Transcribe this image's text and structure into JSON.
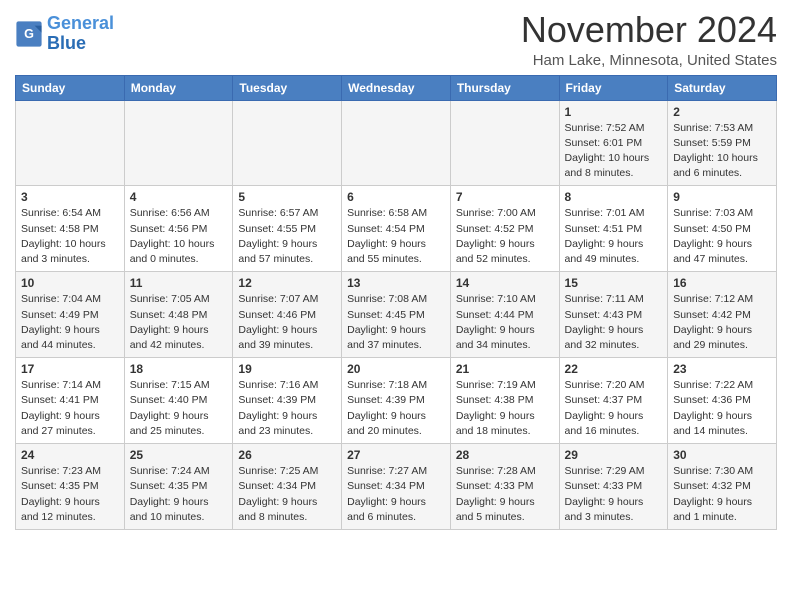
{
  "header": {
    "logo_line1": "General",
    "logo_line2": "Blue",
    "month": "November 2024",
    "location": "Ham Lake, Minnesota, United States"
  },
  "weekdays": [
    "Sunday",
    "Monday",
    "Tuesday",
    "Wednesday",
    "Thursday",
    "Friday",
    "Saturday"
  ],
  "weeks": [
    [
      {
        "day": "",
        "info": ""
      },
      {
        "day": "",
        "info": ""
      },
      {
        "day": "",
        "info": ""
      },
      {
        "day": "",
        "info": ""
      },
      {
        "day": "",
        "info": ""
      },
      {
        "day": "1",
        "info": "Sunrise: 7:52 AM\nSunset: 6:01 PM\nDaylight: 10 hours\nand 8 minutes."
      },
      {
        "day": "2",
        "info": "Sunrise: 7:53 AM\nSunset: 5:59 PM\nDaylight: 10 hours\nand 6 minutes."
      }
    ],
    [
      {
        "day": "3",
        "info": "Sunrise: 6:54 AM\nSunset: 4:58 PM\nDaylight: 10 hours\nand 3 minutes."
      },
      {
        "day": "4",
        "info": "Sunrise: 6:56 AM\nSunset: 4:56 PM\nDaylight: 10 hours\nand 0 minutes."
      },
      {
        "day": "5",
        "info": "Sunrise: 6:57 AM\nSunset: 4:55 PM\nDaylight: 9 hours\nand 57 minutes."
      },
      {
        "day": "6",
        "info": "Sunrise: 6:58 AM\nSunset: 4:54 PM\nDaylight: 9 hours\nand 55 minutes."
      },
      {
        "day": "7",
        "info": "Sunrise: 7:00 AM\nSunset: 4:52 PM\nDaylight: 9 hours\nand 52 minutes."
      },
      {
        "day": "8",
        "info": "Sunrise: 7:01 AM\nSunset: 4:51 PM\nDaylight: 9 hours\nand 49 minutes."
      },
      {
        "day": "9",
        "info": "Sunrise: 7:03 AM\nSunset: 4:50 PM\nDaylight: 9 hours\nand 47 minutes."
      }
    ],
    [
      {
        "day": "10",
        "info": "Sunrise: 7:04 AM\nSunset: 4:49 PM\nDaylight: 9 hours\nand 44 minutes."
      },
      {
        "day": "11",
        "info": "Sunrise: 7:05 AM\nSunset: 4:48 PM\nDaylight: 9 hours\nand 42 minutes."
      },
      {
        "day": "12",
        "info": "Sunrise: 7:07 AM\nSunset: 4:46 PM\nDaylight: 9 hours\nand 39 minutes."
      },
      {
        "day": "13",
        "info": "Sunrise: 7:08 AM\nSunset: 4:45 PM\nDaylight: 9 hours\nand 37 minutes."
      },
      {
        "day": "14",
        "info": "Sunrise: 7:10 AM\nSunset: 4:44 PM\nDaylight: 9 hours\nand 34 minutes."
      },
      {
        "day": "15",
        "info": "Sunrise: 7:11 AM\nSunset: 4:43 PM\nDaylight: 9 hours\nand 32 minutes."
      },
      {
        "day": "16",
        "info": "Sunrise: 7:12 AM\nSunset: 4:42 PM\nDaylight: 9 hours\nand 29 minutes."
      }
    ],
    [
      {
        "day": "17",
        "info": "Sunrise: 7:14 AM\nSunset: 4:41 PM\nDaylight: 9 hours\nand 27 minutes."
      },
      {
        "day": "18",
        "info": "Sunrise: 7:15 AM\nSunset: 4:40 PM\nDaylight: 9 hours\nand 25 minutes."
      },
      {
        "day": "19",
        "info": "Sunrise: 7:16 AM\nSunset: 4:39 PM\nDaylight: 9 hours\nand 23 minutes."
      },
      {
        "day": "20",
        "info": "Sunrise: 7:18 AM\nSunset: 4:39 PM\nDaylight: 9 hours\nand 20 minutes."
      },
      {
        "day": "21",
        "info": "Sunrise: 7:19 AM\nSunset: 4:38 PM\nDaylight: 9 hours\nand 18 minutes."
      },
      {
        "day": "22",
        "info": "Sunrise: 7:20 AM\nSunset: 4:37 PM\nDaylight: 9 hours\nand 16 minutes."
      },
      {
        "day": "23",
        "info": "Sunrise: 7:22 AM\nSunset: 4:36 PM\nDaylight: 9 hours\nand 14 minutes."
      }
    ],
    [
      {
        "day": "24",
        "info": "Sunrise: 7:23 AM\nSunset: 4:35 PM\nDaylight: 9 hours\nand 12 minutes."
      },
      {
        "day": "25",
        "info": "Sunrise: 7:24 AM\nSunset: 4:35 PM\nDaylight: 9 hours\nand 10 minutes."
      },
      {
        "day": "26",
        "info": "Sunrise: 7:25 AM\nSunset: 4:34 PM\nDaylight: 9 hours\nand 8 minutes."
      },
      {
        "day": "27",
        "info": "Sunrise: 7:27 AM\nSunset: 4:34 PM\nDaylight: 9 hours\nand 6 minutes."
      },
      {
        "day": "28",
        "info": "Sunrise: 7:28 AM\nSunset: 4:33 PM\nDaylight: 9 hours\nand 5 minutes."
      },
      {
        "day": "29",
        "info": "Sunrise: 7:29 AM\nSunset: 4:33 PM\nDaylight: 9 hours\nand 3 minutes."
      },
      {
        "day": "30",
        "info": "Sunrise: 7:30 AM\nSunset: 4:32 PM\nDaylight: 9 hours\nand 1 minute."
      }
    ]
  ]
}
